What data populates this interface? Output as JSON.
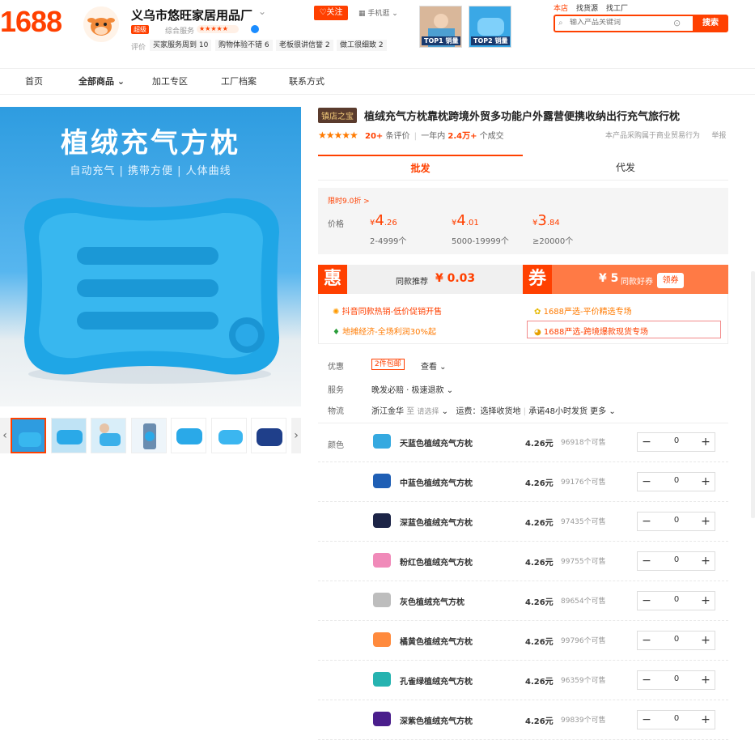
{
  "header": {
    "logo": "1688",
    "shop_name": "义乌市悠旺家居用品厂",
    "shop_badge": "超级",
    "composite_label": "综合服务",
    "rating_label": "评价",
    "tags": [
      "买家服务周到 10",
      "购物体验不错 6",
      "老板很讲信誉 2",
      "做工很细致 2"
    ],
    "follow_label": "关注",
    "mobile_label": "手机逛",
    "top_products": [
      "TOP1 销量",
      "TOP2 销量"
    ],
    "nav_tabs": [
      "本店",
      "找货源",
      "找工厂"
    ],
    "search_placeholder": "输入产品关键词",
    "search_button": "搜索"
  },
  "navbar": [
    "首页",
    "全部商品",
    "加工专区",
    "工厂档案",
    "联系方式"
  ],
  "gallery": {
    "title": "植绒充气方枕",
    "subtitle": "自动充气 | 携带方便 | 人体曲线"
  },
  "product": {
    "badge": "镇店之宝",
    "title": "植绒充气方枕靠枕跨境外贸多功能户外露营便携收纳出行充气旅行枕",
    "review_count": "20+",
    "review_label": "条评价",
    "sales_prefix": "一年内",
    "sales_count": "2.4万+",
    "sales_label": "个成交",
    "report_note": "本产品采购属于商业贸易行为",
    "report": "举报"
  },
  "tabs": {
    "wholesale": "批发",
    "dropship": "代发"
  },
  "pricing": {
    "promo_tag": "限时9.0折 >",
    "label": "价格",
    "tiers": [
      {
        "yen": "¥",
        "int": "4",
        "dec": ".26",
        "range": "2-4999个"
      },
      {
        "yen": "¥",
        "int": "4",
        "dec": ".01",
        "range": "5000-19999个"
      },
      {
        "yen": "¥",
        "int": "3",
        "dec": ".84",
        "range": "≥20000个"
      }
    ]
  },
  "deals": {
    "hui_char": "惠",
    "hui_text": "同款推荐",
    "hui_value": "¥ 0.03",
    "quan_char": "券",
    "quan_value": "¥ 5",
    "quan_text": "同款好券",
    "quan_button": "领券",
    "promos": [
      "抖音同款热销-低价促销开售",
      "1688严选-平价精选专场",
      "地摊经济-全场利润30%起",
      "1688严选-跨境爆款现货专场"
    ]
  },
  "options": {
    "youhui_label": "优惠",
    "youhui_tag": "2件包邮",
    "youhui_more": "查看",
    "service_label": "服务",
    "service_text": "晚发必赔 · 极速退款",
    "logistics_label": "物流",
    "logistics_from": "浙江金华",
    "logistics_to": "至",
    "logistics_select": "请选择",
    "logistics_fee": "运费：选择收货地",
    "logistics_promise": "承诺48小时发货",
    "logistics_more": "更多",
    "color_label": "颜色"
  },
  "skus": [
    {
      "name": "天蓝色植绒充气方枕",
      "price": "4.26元",
      "stock": "96918个可售",
      "qty": "0",
      "color": "#35a9e0"
    },
    {
      "name": "中蓝色植绒充气方枕",
      "price": "4.26元",
      "stock": "99176个可售",
      "qty": "0",
      "color": "#1f5fb5"
    },
    {
      "name": "深蓝色植绒充气方枕",
      "price": "4.26元",
      "stock": "97435个可售",
      "qty": "0",
      "color": "#1c2447"
    },
    {
      "name": "粉红色植绒充气方枕",
      "price": "4.26元",
      "stock": "99755个可售",
      "qty": "0",
      "color": "#f08ab9"
    },
    {
      "name": "灰色植绒充气方枕",
      "price": "4.26元",
      "stock": "89654个可售",
      "qty": "0",
      "color": "#bdbdbd"
    },
    {
      "name": "橘黄色植绒充气方枕",
      "price": "4.26元",
      "stock": "99796个可售",
      "qty": "0",
      "color": "#ff8a3d"
    },
    {
      "name": "孔雀绿植绒充气方枕",
      "price": "4.26元",
      "stock": "96359个可售",
      "qty": "0",
      "color": "#26b3b0"
    },
    {
      "name": "深紫色植绒充气方枕",
      "price": "4.26元",
      "stock": "99839个可售",
      "qty": "0",
      "color": "#4a1e8c"
    }
  ],
  "stepper": {
    "minus": "−",
    "plus": "+"
  }
}
